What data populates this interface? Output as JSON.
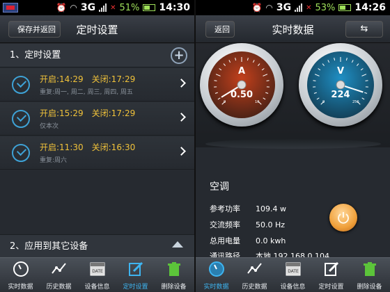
{
  "status_left": {
    "network": "3G",
    "battery_pct": "51%",
    "time": "14:30"
  },
  "status_right": {
    "network": "3G",
    "battery_pct": "53%",
    "time": "14:26"
  },
  "timer_screen": {
    "back_label": "保存并返回",
    "title": "定时设置",
    "section1": "1、定时设置",
    "add_icon": "plus-icon",
    "timers": [
      {
        "on": "开启:14:29",
        "off": "关闭:17:29",
        "repeat": "重复:周一, 周二, 周三, 周四, 周五"
      },
      {
        "on": "开启:15:29",
        "off": "关闭:17:29",
        "repeat": "仅本次"
      },
      {
        "on": "开启:11:30",
        "off": "关闭:16:30",
        "repeat": "重复:周六"
      }
    ],
    "section2": "2、应用到其它设备"
  },
  "realtime_screen": {
    "back_label": "返回",
    "title": "实时数据",
    "sync_icon": "sync-arrows-icon",
    "gauge_current": {
      "unit": "A",
      "value": "0.50",
      "scale_min": "0",
      "scale_max": "10",
      "fraction": 0.05,
      "color": "#c2401c"
    },
    "gauge_voltage": {
      "unit": "V",
      "value": "224",
      "scale_min": "0",
      "scale_max": "250",
      "fraction": 0.9,
      "color": "#1a7fb0"
    },
    "device_name": "空调",
    "rows": [
      {
        "key": "参考功率",
        "value": "109.4  w"
      },
      {
        "key": "交流频率",
        "value": "50.0  Hz"
      },
      {
        "key": "总用电量",
        "value": "0.0  kwh"
      },
      {
        "key": "通讯路径",
        "value": "本地 192.168.0.104"
      }
    ],
    "power_icon": "power-icon"
  },
  "nav": [
    {
      "label": "实时数据",
      "icon": "gauge-icon"
    },
    {
      "label": "历史数据",
      "icon": "chart-line-icon"
    },
    {
      "label": "设备信息",
      "icon": "calendar-date-icon",
      "icon_text": "DATE"
    },
    {
      "label": "定时设置",
      "icon": "edit-icon"
    },
    {
      "label": "删除设备",
      "icon": "trash-icon"
    }
  ],
  "colors": {
    "accent_blue": "#3ea2d6",
    "timer_yellow": "#f0c23a",
    "active_nav": "#3eb4f0",
    "battery_green": "#9fe05a"
  }
}
